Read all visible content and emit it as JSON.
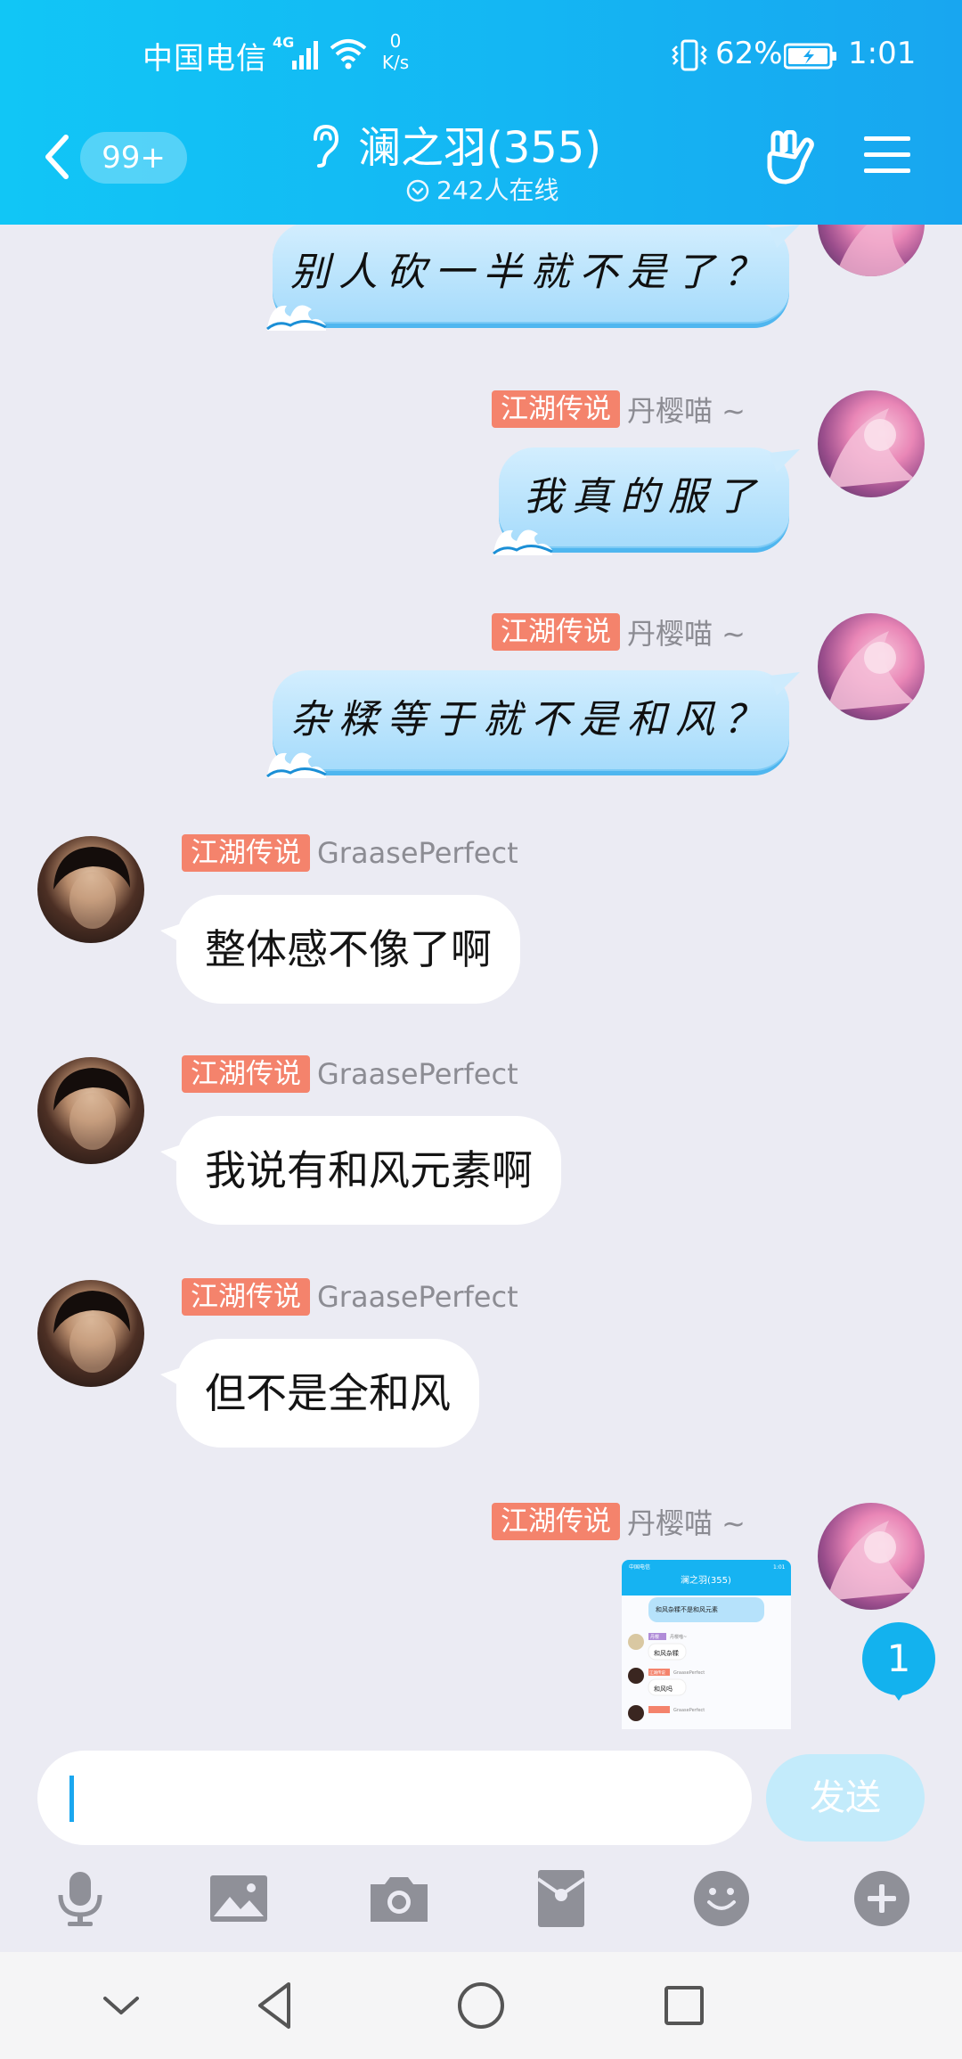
{
  "status_bar": {
    "carrier": "中国电信",
    "network": "4G",
    "speed_value": "0",
    "speed_unit": "K/s",
    "battery": "62%",
    "time": "1:01"
  },
  "header": {
    "unread": "99+",
    "title": "澜之羽(355)",
    "online": "242人在线"
  },
  "messages": [
    {
      "side": "right",
      "style": "blue",
      "text": "别人砍一半就不是了？"
    },
    {
      "side": "right",
      "style": "blue",
      "tag": "江湖传说",
      "sender": "丹樱喵 ~",
      "text": "我真的服了"
    },
    {
      "side": "right",
      "style": "blue",
      "tag": "江湖传说",
      "sender": "丹樱喵 ~",
      "text": "杂糅等于就不是和风？"
    },
    {
      "side": "left",
      "style": "white",
      "tag": "江湖传说",
      "sender": "GraasePerfect",
      "text": "整体感不像了啊"
    },
    {
      "side": "left",
      "style": "white",
      "tag": "江湖传说",
      "sender": "GraasePerfect",
      "text": "我说有和风元素啊"
    },
    {
      "side": "left",
      "style": "white",
      "tag": "江湖传说",
      "sender": "GraasePerfect",
      "text": "但不是全和风"
    },
    {
      "side": "right",
      "style": "image",
      "tag": "江湖传说",
      "sender": "丹樱喵 ~",
      "text": ""
    }
  ],
  "thumbnail": {
    "status": "中国电信",
    "time": "1:01",
    "title": "澜之羽(355)",
    "tag_a": "丹樱",
    "name_a": "丹樱喵~",
    "text_a": "和风杂糅不是和风元素",
    "line1": "和风杂糅",
    "tag_b": "江湖传说",
    "name_b": "GraasePerfect",
    "line2": "和风吗",
    "name_c": "GraasePerfect"
  },
  "unread_float": "1",
  "input": {
    "value": "",
    "send_label": "发送"
  },
  "toolbar": [
    "mic-icon",
    "image-icon",
    "camera-icon",
    "red-packet-icon",
    "emoji-icon",
    "plus-icon"
  ],
  "colors": {
    "header": "#14b6f3",
    "title_tag": "#f4836c",
    "send": "#c3ebfb",
    "badge": "#13b2ee"
  }
}
